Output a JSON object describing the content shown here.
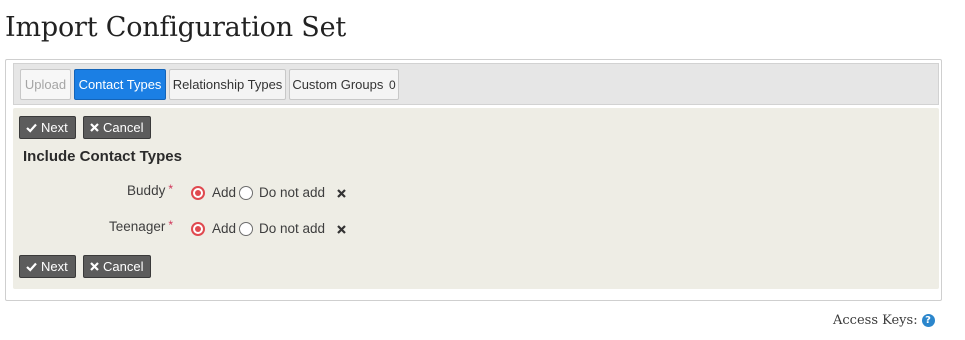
{
  "page": {
    "title": "Import Configuration Set"
  },
  "tabs": [
    {
      "label": "Upload",
      "state": "disabled"
    },
    {
      "label": "Contact Types",
      "state": "active"
    },
    {
      "label": "Relationship Types",
      "state": "normal"
    },
    {
      "label": "Custom Groups",
      "count": "0",
      "state": "normal"
    }
  ],
  "buttons": {
    "next_label": "Next",
    "cancel_label": "Cancel"
  },
  "section": {
    "title": "Include Contact Types"
  },
  "fields": [
    {
      "label": "Buddy",
      "required_mark": "*",
      "selected": "Add",
      "option_add": "Add",
      "option_do_not_add": "Do not add"
    },
    {
      "label": "Teenager",
      "required_mark": "*",
      "selected": "Add",
      "option_add": "Add",
      "option_do_not_add": "Do not add"
    }
  ],
  "footer": {
    "access_keys_label": "Access Keys:",
    "help_icon": "?"
  },
  "colors": {
    "active_tab": "#1b7fe4",
    "button": "#5c5c5c",
    "content_bg": "#eeede5",
    "radio_selected": "#e0494f",
    "required": "#cf3458",
    "help_icon": "#2b86cc"
  }
}
